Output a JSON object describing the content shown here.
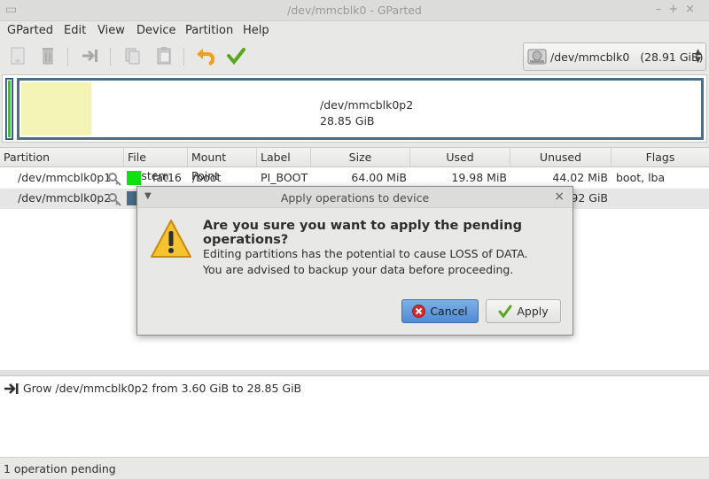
{
  "window": {
    "title": "/dev/mmcblk0 - GParted"
  },
  "menu": {
    "items": [
      "GParted",
      "Edit",
      "View",
      "Device",
      "Partition",
      "Help"
    ]
  },
  "toolbar": {
    "buttons": [
      "new-icon",
      "delete-icon",
      "resize-move-icon",
      "copy-icon",
      "paste-icon",
      "undo-icon",
      "apply-icon"
    ],
    "device_name": "/dev/mmcblk0",
    "device_size": "(28.91 GiB)"
  },
  "visual": {
    "partition_name": "/dev/mmcblk0p2",
    "partition_size": "28.85 GiB",
    "colors": {
      "fat16": "#10e010",
      "ext4": "#4a6d88",
      "used": "#f5f4b7"
    }
  },
  "table": {
    "columns": [
      "Partition",
      "File System",
      "Mount Point",
      "Label",
      "Size",
      "Used",
      "Unused",
      "Flags"
    ],
    "rows": [
      {
        "partition": "/dev/mmcblk0p1",
        "fs": "fat16",
        "mount": "/boot",
        "label": "PI_BOOT",
        "size": "64.00 MiB",
        "used": "19.98 MiB",
        "unused": "44.02 MiB",
        "flags": "boot, lba"
      },
      {
        "partition": "/dev/mmcblk0p2",
        "fs": "",
        "mount": "",
        "label": "",
        "size": "",
        "used": "",
        "unused": "92 GiB",
        "flags": ""
      }
    ]
  },
  "operations": {
    "items": [
      "Grow /dev/mmcblk0p2 from 3.60 GiB to 28.85 GiB"
    ]
  },
  "status": {
    "text": "1 operation pending"
  },
  "dialog": {
    "title": "Apply operations to device",
    "heading": "Are you sure you want to apply the pending operations?",
    "line1": "Editing partitions has the potential to cause LOSS of DATA.",
    "line2": "You are advised to backup your data before proceeding.",
    "cancel_label": "Cancel",
    "apply_label": "Apply"
  }
}
